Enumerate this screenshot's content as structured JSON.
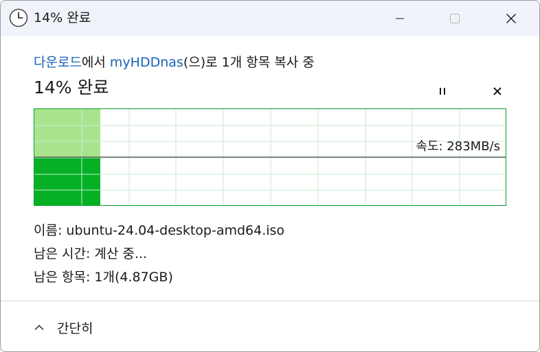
{
  "window": {
    "title": "14% 완료",
    "icon": "clock-icon"
  },
  "status": {
    "source": "다운로드",
    "text1": "에서 ",
    "destination": "myHDDnas",
    "text2": "(으)로 1개 항목 복사 중"
  },
  "progress": {
    "title": "14% 완료",
    "percent": 14
  },
  "graph": {
    "speed_text": "속도: 283MB/s",
    "fill_color_completed": "#a8e48e",
    "fill_color_current": "#06b025",
    "grid_color": "#c9ebcf"
  },
  "details": {
    "name": "이름: ubuntu-24.04-desktop-amd64.iso",
    "time_remaining": "남은 시간: 계산 중...",
    "items_remaining": "남은 항목: 1개(4.87GB)"
  },
  "footer": {
    "collapse_label": "간단히"
  }
}
